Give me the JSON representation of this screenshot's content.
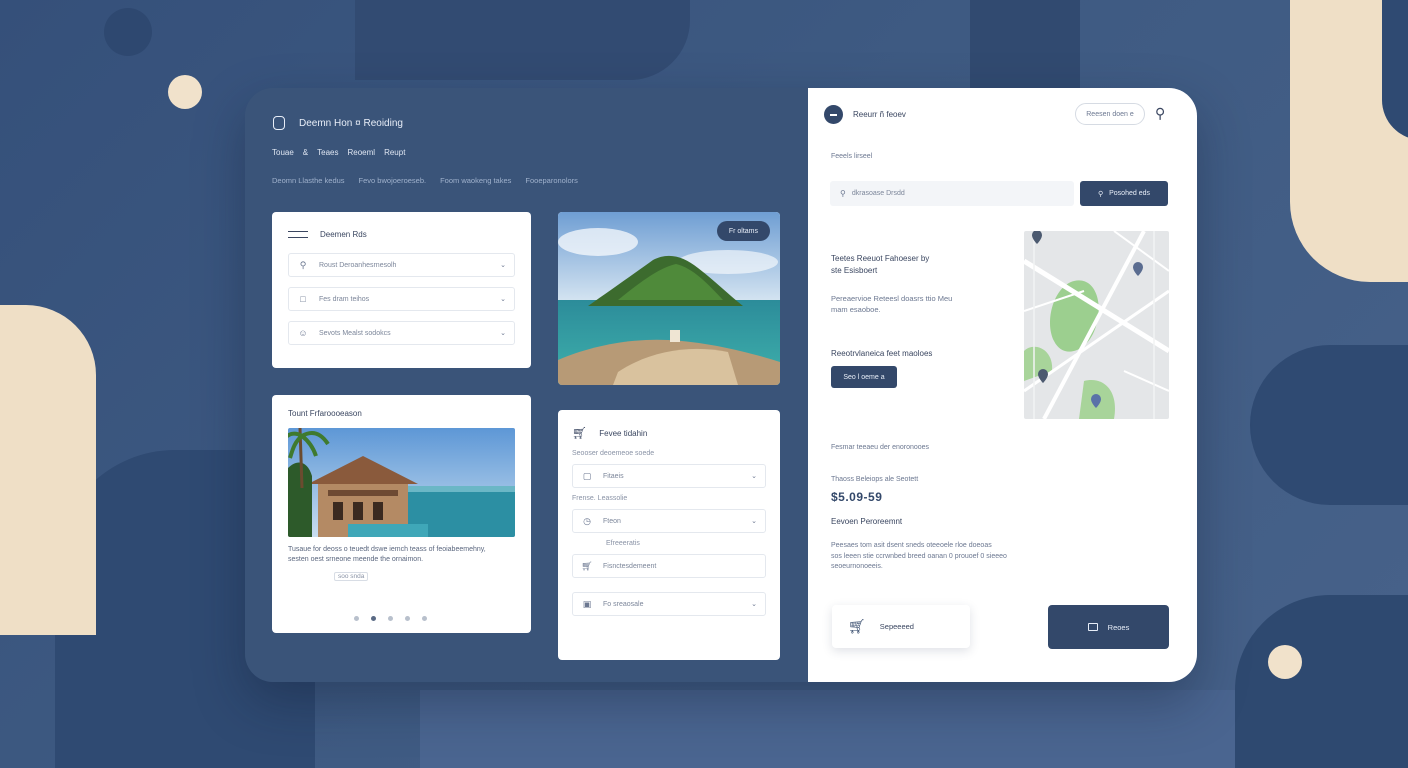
{
  "brand": {
    "title": "Deemn Hon ¤ Reoiding"
  },
  "nav": [
    "Touae",
    "&",
    "Teaes",
    "Reoeml",
    "Reupt"
  ],
  "subnav": [
    "Deomn Llasthe kedus",
    "Fevo bwojoeroeseb.",
    "Foom waokeng takes",
    "Fooeparonolors"
  ],
  "search_card": {
    "title": "Deemen Rds",
    "fields": [
      {
        "icon": "search-icon",
        "value": "Roust Deroanhesrnesolh"
      },
      {
        "icon": "calendar-icon",
        "value": "Fes dram teihos"
      },
      {
        "icon": "guests-icon",
        "value": "Sevots Mealst sodokcs"
      }
    ]
  },
  "photo_card": {
    "badge": "Fr oltams"
  },
  "feature_card": {
    "title": "Tount Frfaroooeason",
    "description": "Tusaue for deoss o teuedt dswe iemch teass of feoiabeemehny, sesten oest srneone meende the ornaimon.",
    "link": "soo snda"
  },
  "cart_card": {
    "title": "Fevee tidahin",
    "label1": "Seooser deoemeoe soede",
    "field1": "Fitaeis",
    "label2": "Frense. Leassolie",
    "field2": "Fteon",
    "label3": "Efreeeratis",
    "field3": "Fisnctesdemeent",
    "field4": "Fo sreaosale"
  },
  "right": {
    "title": "Reeurr ñ feoev",
    "pill": "Reesen doen e",
    "section_label": "Feeels lirseel",
    "search_value": "dkrasoase Drsdd",
    "search_button": "Posohed eds",
    "heading1_line1": "Teetes Reeuot Fahoeser by",
    "heading1_line2": "ste Esisboert",
    "body1_line1": "Pereaervioe Reteesl doasrs ttio Meu",
    "body1_line2": "mam esaoboe.",
    "heading2": "Reeotrvlaneica feet maoloes",
    "small_button": "Seo l oeme a",
    "label2": "Fesmar teeaeu der enoronooes",
    "price_label": "Thaoss Beleiops ale Seotett",
    "price": "$5.09-59",
    "heading3": "Eevoen Peroreemnt",
    "body2_line1": "Peesaes tom asit dsent sneds oteeoele rloe doeoas",
    "body2_line2": "sos leeen stie ccrwnbed breed oanan 0 prouoef 0 sieeeo",
    "body2_line3": "seoeurnonoeeis.",
    "cart_button": "Sepeeeed",
    "checkout_button": "Reoes"
  },
  "colors": {
    "navy": "#33486a",
    "panel": "#3a5479",
    "cream": "#efdfc6",
    "bg": "#3c5478"
  }
}
